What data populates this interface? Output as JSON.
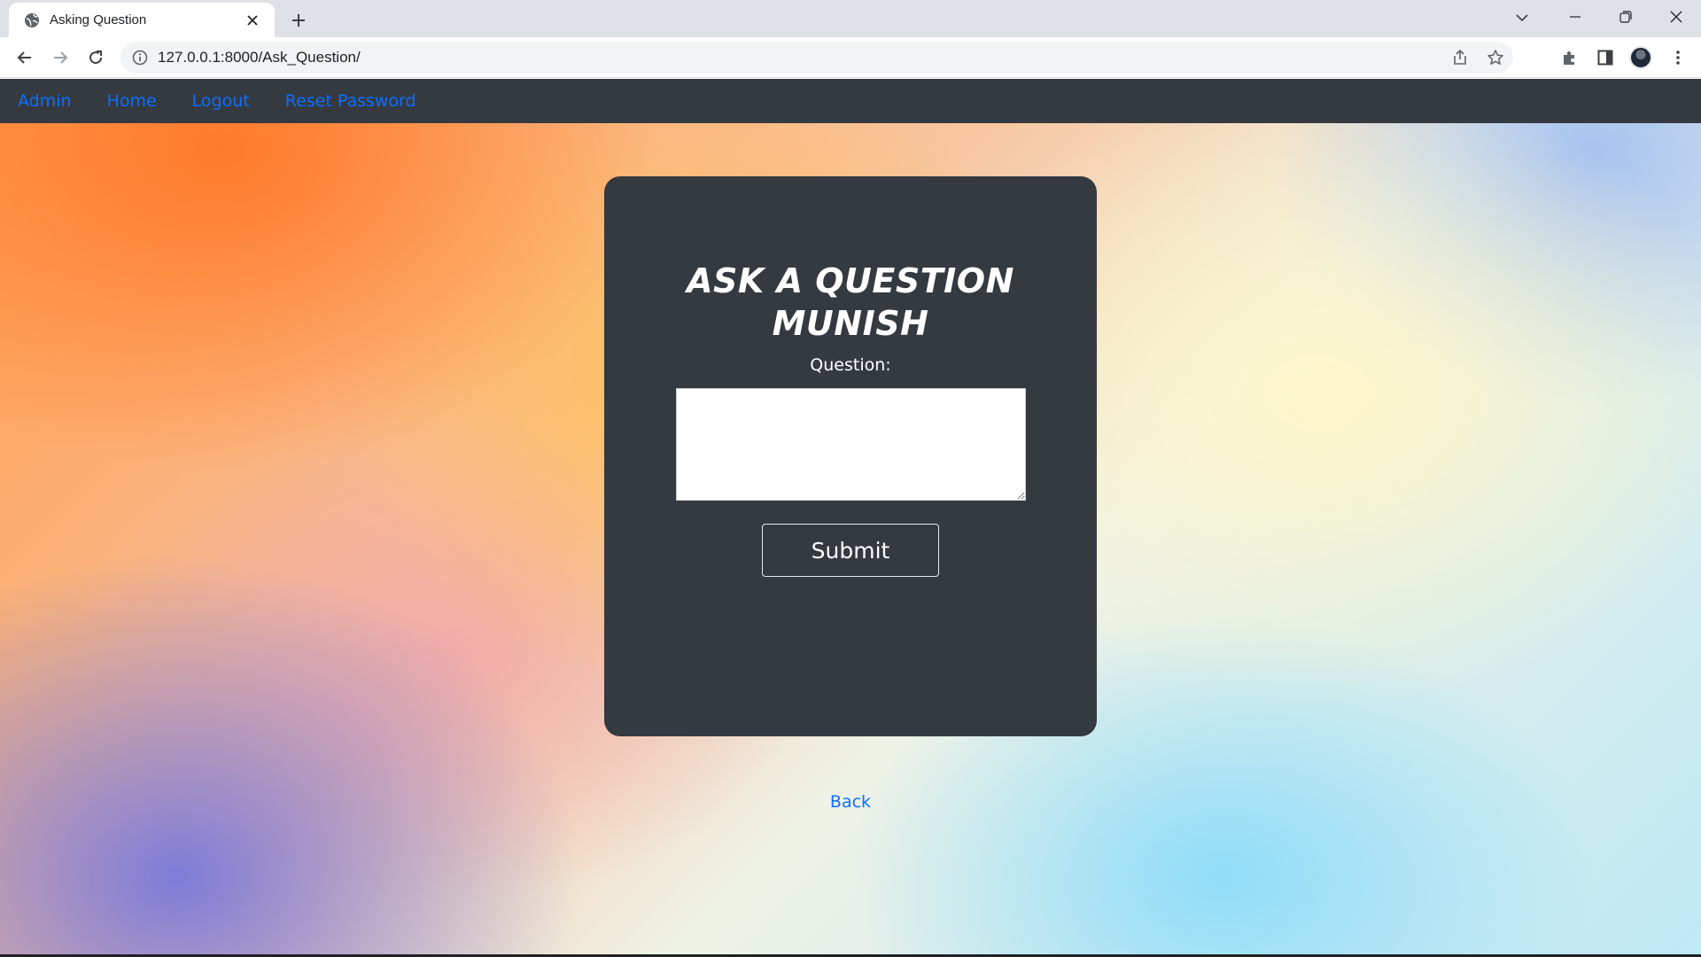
{
  "browser": {
    "tab_title": "Asking Question",
    "url": "127.0.0.1:8000/Ask_Question/"
  },
  "nav": {
    "items": [
      {
        "label": "Admin"
      },
      {
        "label": "Home"
      },
      {
        "label": "Logout"
      },
      {
        "label": "Reset Password"
      }
    ],
    "link_color": "#0d6efd",
    "background": "#343a40"
  },
  "form": {
    "title_line1": "ASK A QUESTION",
    "title_line2": "MUNISH",
    "question_label": "Question:",
    "question_value": "",
    "submit_label": "Submit",
    "background": "#343a40"
  },
  "footer": {
    "back_label": "Back"
  },
  "icons": [
    "globe-icon",
    "close-icon",
    "plus-icon",
    "chevron-down-icon",
    "minimize-icon",
    "restore-icon",
    "window-close-icon",
    "back-arrow-icon",
    "forward-arrow-icon",
    "reload-icon",
    "info-icon",
    "share-icon",
    "star-icon",
    "extensions-icon",
    "side-panel-icon",
    "avatar",
    "more-vert-icon"
  ]
}
